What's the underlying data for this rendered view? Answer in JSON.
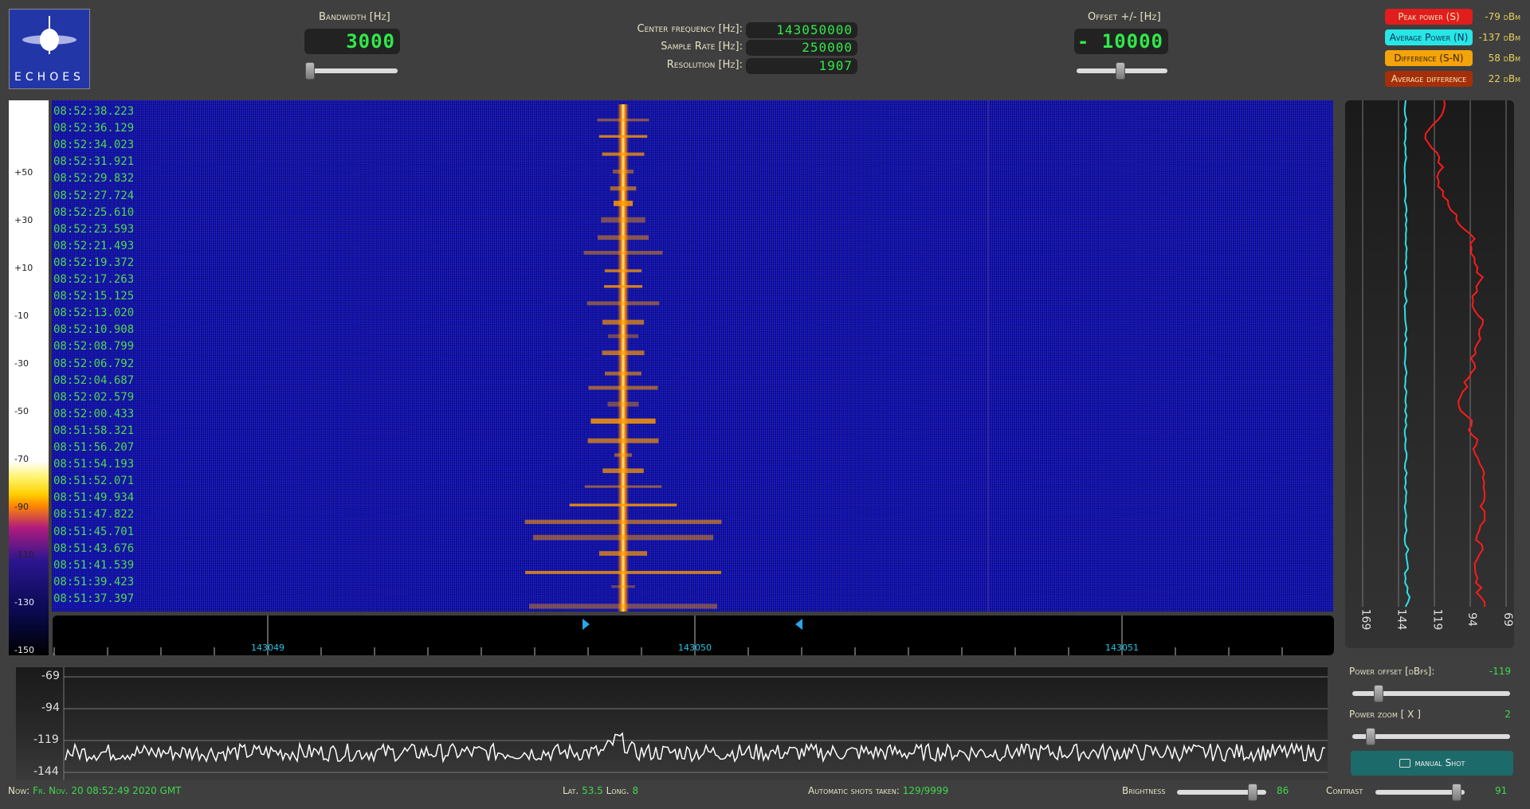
{
  "logo": {
    "text": "ECHOES"
  },
  "bandwidth": {
    "label": "Bandwidth [Hz]",
    "value": "3000"
  },
  "center": {
    "freq_label": "Center frequency [Hz]:",
    "freq_value": "143050000",
    "rate_label": "Sample Rate [Hz]:",
    "rate_value": "250000",
    "res_label": "Resolution [Hz]:",
    "res_value": "1907"
  },
  "offset": {
    "label": "Offset +/- [Hz]",
    "value": "- 10000"
  },
  "power_badges": [
    {
      "label": "Peak power (S)",
      "value": "-79 dBm",
      "bg": "#e11d1d",
      "fg": "#f6e9b8"
    },
    {
      "label": "Average Power (N)",
      "value": "-137 dBm",
      "bg": "#27e6e6",
      "fg": "#0b2a55"
    },
    {
      "label": "Difference (S-N)",
      "value": "58 dBm",
      "bg": "#f4a40a",
      "fg": "#3a2200"
    },
    {
      "label": "Average difference",
      "value": "22 dBm",
      "bg": "#a52f0a",
      "fg": "#f6e9b8"
    }
  ],
  "timestamps": [
    "08:52:38.223",
    "08:52:36.129",
    "08:52:34.023",
    "08:52:31.921",
    "08:52:29.832",
    "08:52:27.724",
    "08:52:25.610",
    "08:52:23.593",
    "08:52:21.493",
    "08:52:19.372",
    "08:52:17.263",
    "08:52:15.125",
    "08:52:13.020",
    "08:52:10.908",
    "08:52:08.799",
    "08:52:06.792",
    "08:52:04.687",
    "08:52:02.579",
    "08:52:00.433",
    "08:51:58.321",
    "08:51:56.207",
    "08:51:54.193",
    "08:51:52.071",
    "08:51:49.934",
    "08:51:47.822",
    "08:51:45.701",
    "08:51:43.676",
    "08:51:41.539",
    "08:51:39.423",
    "08:51:37.397"
  ],
  "colorbar_labels": [
    "+50",
    "+30",
    "+10",
    "-10",
    "-30",
    "-50",
    "-70",
    "-90",
    "-110",
    "-130",
    "-150"
  ],
  "freq_scale": [
    "143049",
    "143050",
    "143051"
  ],
  "side_plot_labels": [
    "169",
    "144",
    "119",
    "94",
    "69"
  ],
  "bottom_plot_labels": [
    "-69",
    "-94",
    "-119",
    "-144"
  ],
  "controls": {
    "power_offset_label": "Power offset [dBfs]:",
    "power_offset_value": "-119",
    "power_zoom_label": "Power zoom [ X ]",
    "power_zoom_value": "2",
    "manual_shot_label": "manual Shot"
  },
  "footer": {
    "now_label": "Now:",
    "now_value": "Fr. Nov. 20 08:52:49 2020 GMT",
    "lat_label": "Lat.",
    "lat_value": "53.5",
    "long_label": "Long.",
    "long_value": "8",
    "shots_label": "Automatic shots taken:",
    "shots_value": "129/9999",
    "brightness_label": "Brightness",
    "brightness_value": "86",
    "contrast_label": "Contrast",
    "contrast_value": "91"
  },
  "sliders": {
    "bandwidth": 0.0,
    "offset": 0.45,
    "power_offset": 0.17,
    "power_zoom": 0.12,
    "brightness": 0.86,
    "contrast": 0.91
  }
}
